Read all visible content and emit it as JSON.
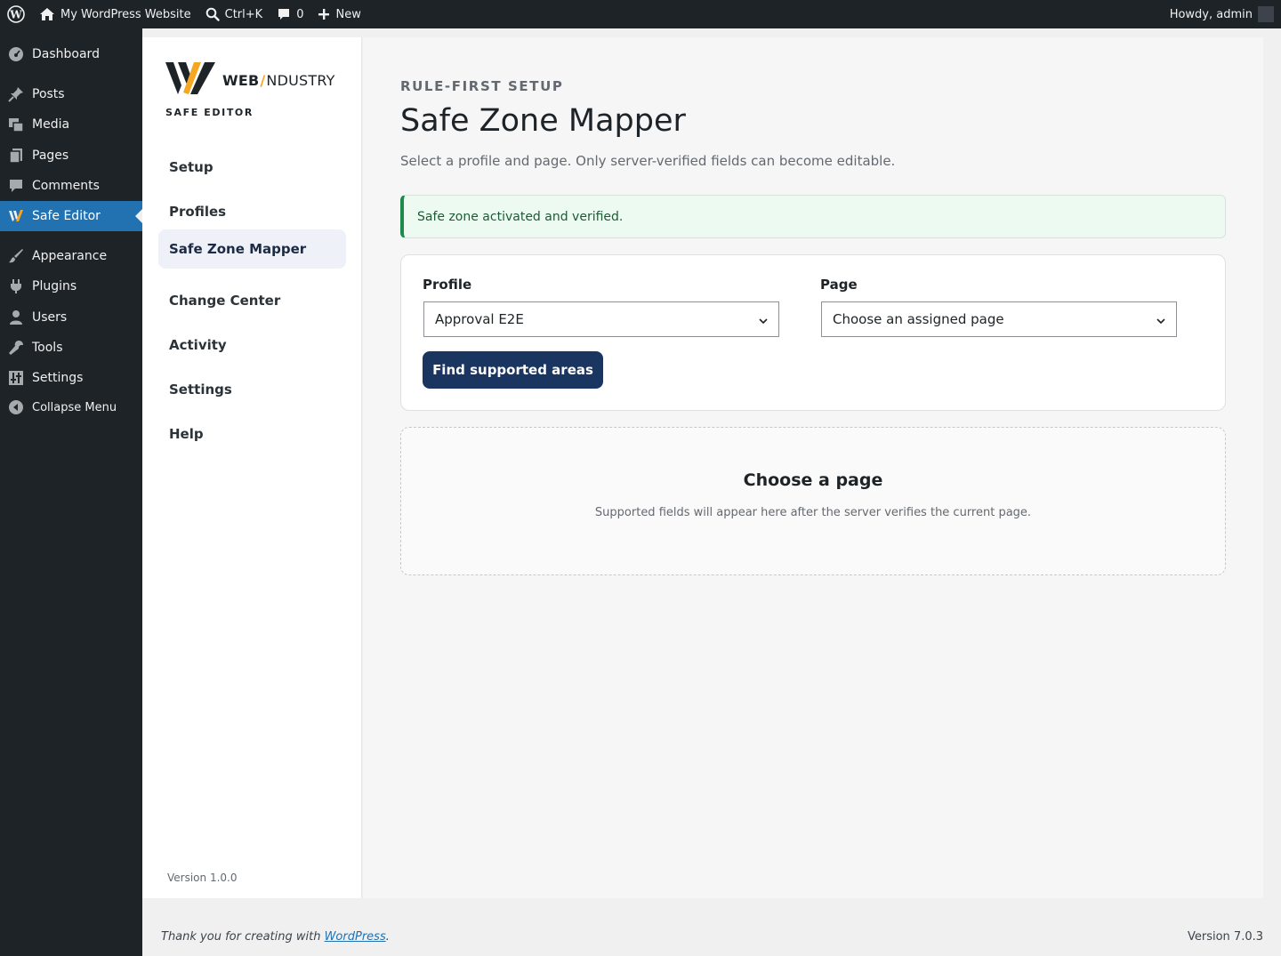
{
  "admin_bar": {
    "site_name": "My WordPress Website",
    "search_shortcut": "Ctrl+K",
    "comments_count": "0",
    "new_label": "New",
    "greeting": "Howdy, admin"
  },
  "admin_menu": {
    "items": [
      {
        "label": "Dashboard",
        "icon": "dashboard-icon"
      },
      {
        "label": "Posts",
        "icon": "pin-icon"
      },
      {
        "label": "Media",
        "icon": "media-icon"
      },
      {
        "label": "Pages",
        "icon": "pages-icon"
      },
      {
        "label": "Comments",
        "icon": "comment-icon"
      },
      {
        "label": "Safe Editor",
        "icon": "webindustry-logo-icon",
        "current": true
      },
      {
        "label": "Appearance",
        "icon": "brush-icon"
      },
      {
        "label": "Plugins",
        "icon": "plugin-icon"
      },
      {
        "label": "Users",
        "icon": "user-icon"
      },
      {
        "label": "Tools",
        "icon": "wrench-icon"
      },
      {
        "label": "Settings",
        "icon": "settings-icon"
      }
    ],
    "collapse_label": "Collapse Menu"
  },
  "plugin": {
    "brand_web": "WEB",
    "brand_slash": "/",
    "brand_industry": "NDUSTRY",
    "brand_sub": "SAFE EDITOR",
    "nav": [
      {
        "label": "Setup"
      },
      {
        "label": "Profiles"
      },
      {
        "label": "Safe Zone Mapper",
        "active": true
      },
      {
        "label": "Change Center"
      },
      {
        "label": "Activity"
      },
      {
        "label": "Settings"
      },
      {
        "label": "Help"
      }
    ],
    "version": "Version 1.0.0"
  },
  "main": {
    "eyebrow": "RULE-FIRST SETUP",
    "title": "Safe Zone Mapper",
    "subtitle": "Select a profile and page. Only server-verified fields can become editable.",
    "notice": "Safe zone activated and verified.",
    "profile_label": "Profile",
    "profile_value": "Approval E2E",
    "page_label": "Page",
    "page_value": "Choose an assigned page",
    "button_label": "Find supported areas",
    "empty_title": "Choose a page",
    "empty_text": "Supported fields will appear here after the server verifies the current page."
  },
  "footer": {
    "thanks_prefix": "Thank you for creating with ",
    "thanks_link": "WordPress",
    "thanks_suffix": ".",
    "version": "Version 7.0.3"
  },
  "colors": {
    "admin_dark": "#1d2327",
    "current_menu": "#2271b1",
    "primary_button": "#1a3660",
    "notice_green": "#1e8a4a",
    "brand_accent": "#f5a623"
  }
}
